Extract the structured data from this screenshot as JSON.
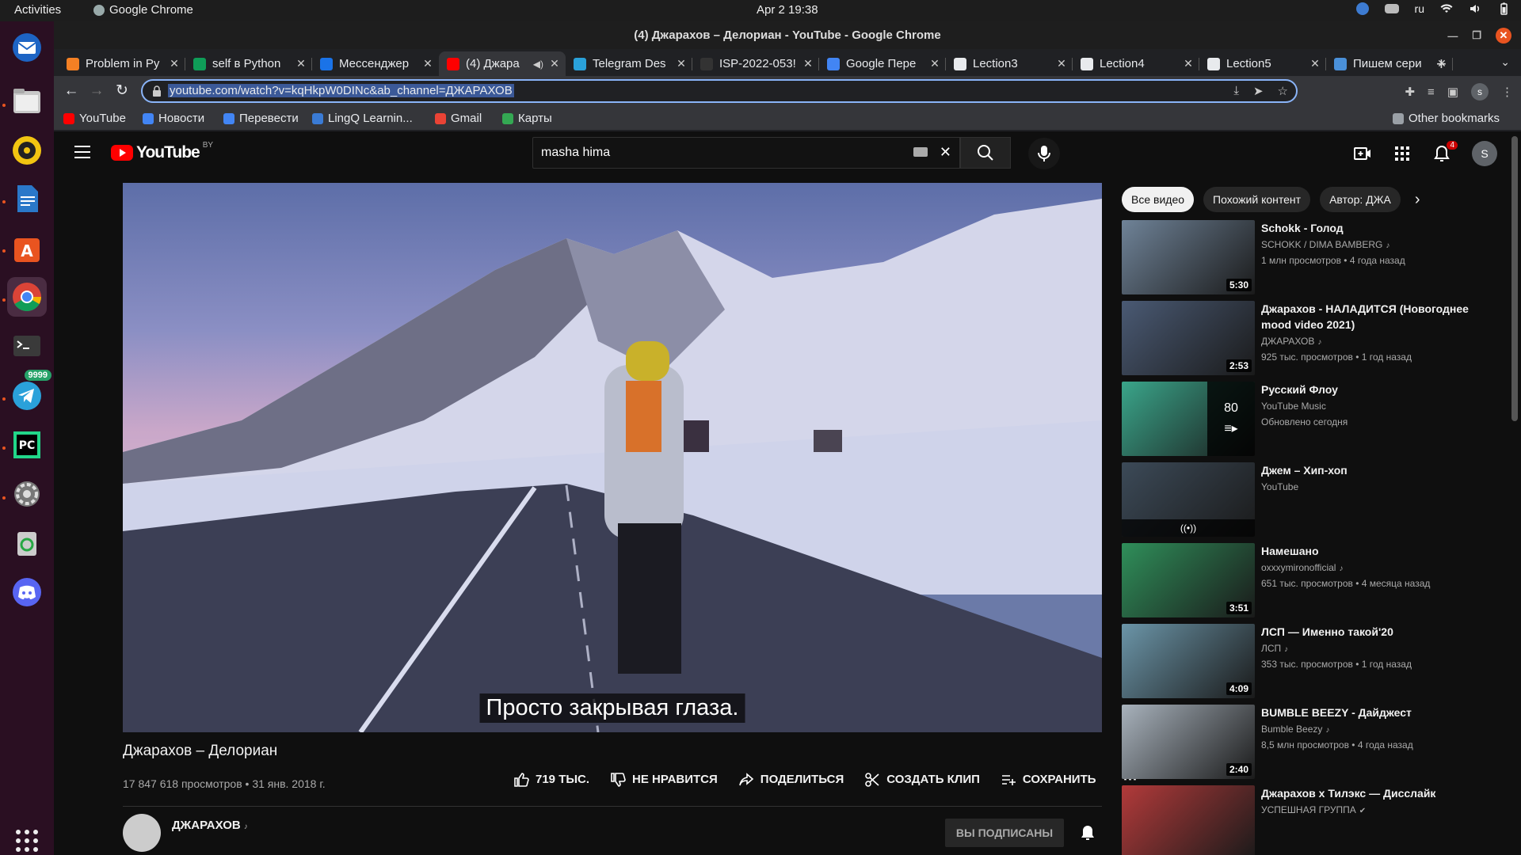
{
  "desktop": {
    "activities": "Activities",
    "app_name": "Google Chrome",
    "clock": "Apr 2  19:38",
    "lang": "ru",
    "telegram_badge": "9999"
  },
  "window": {
    "title": "(4) Джарахов – Делориан - YouTube - Google Chrome"
  },
  "tabs": [
    {
      "label": "Problem in Py",
      "color": "#f48024"
    },
    {
      "label": "self в Python",
      "color": "#0f9d58"
    },
    {
      "label": "Мессенджер",
      "color": "#1a73e8"
    },
    {
      "label": "(4) Джара",
      "color": "#ff0000"
    },
    {
      "label": "Telegram Des",
      "color": "#2aa1da"
    },
    {
      "label": "ISP-2022-053!",
      "color": "#333333"
    },
    {
      "label": "Google Пере",
      "color": "#4285f4"
    },
    {
      "label": "Lection3",
      "color": "#e8eaed"
    },
    {
      "label": "Lection4",
      "color": "#e8eaed"
    },
    {
      "label": "Lection5",
      "color": "#e8eaed"
    },
    {
      "label": "Пишем сери",
      "color": "#4a90d9"
    }
  ],
  "omnibox": {
    "url": "youtube.com/watch?v=kqHkpW0DINc&ab_channel=ДЖАРАХОВ"
  },
  "bookmarks": [
    {
      "label": "YouTube",
      "color": "#ff0000"
    },
    {
      "label": "Новости",
      "color": "#4285f4"
    },
    {
      "label": "Перевести",
      "color": "#4285f4"
    },
    {
      "label": "LingQ Learnin...",
      "color": "#3a7bd5"
    },
    {
      "label": "Gmail",
      "color": "#ea4335"
    },
    {
      "label": "Карты",
      "color": "#34a853"
    }
  ],
  "other_bookmarks": "Other bookmarks",
  "youtube": {
    "logo_text": "YouTube",
    "country": "BY",
    "search_query": "masha hima",
    "notif_count": "4",
    "avatar_letter": "S",
    "subtitle": "Просто закрывая глаза.",
    "video_title": "Джарахов – Делориан",
    "video_meta": "17 847 618 просмотров • 31 янв. 2018 г.",
    "actions": {
      "like": "719 ТЫС.",
      "dislike": "НЕ НРАВИТСЯ",
      "share": "ПОДЕЛИТЬСЯ",
      "clip": "СОЗДАТЬ КЛИП",
      "save": "СОХРАНИТЬ"
    },
    "channel_name": "ДЖАРАХОВ",
    "subscribe_label": "ВЫ ПОДПИСАНЫ",
    "chips": [
      "Все видео",
      "Похожий контент",
      "Автор: ДЖА"
    ],
    "recs": [
      {
        "title": "Schokk - Голод",
        "channel": "SCHOKK / DIMA BAMBERG",
        "stats": "1 млн просмотров • 4 года назад",
        "duration": "5:30",
        "thumb": "#6f8398"
      },
      {
        "title": "Джарахов - НАЛАДИТСЯ (Новогоднее mood video 2021)",
        "channel": "ДЖАРАХОВ",
        "stats": "925 тыс. просмотров • 1 год назад",
        "duration": "2:53",
        "thumb": "#4a5a74"
      },
      {
        "title": "Русский Флоу",
        "channel": "YouTube Music",
        "stats": "Обновлено сегодня",
        "playlist_count": "80",
        "thumb": "#3aa58a"
      },
      {
        "title": "Джем – Хип-хоп",
        "channel": "YouTube",
        "stats": "",
        "thumb": "#3c4a58"
      },
      {
        "title": "Намешано",
        "channel": "oxxxymironofficial",
        "stats": "651 тыс. просмотров • 4 месяца назад",
        "duration": "3:51",
        "thumb": "#2f8f5a"
      },
      {
        "title": "ЛСП — Именно такой'20",
        "channel": "ЛСП",
        "stats": "353 тыс. просмотров • 1 год назад",
        "duration": "4:09",
        "thumb": "#6b95a8"
      },
      {
        "title": "BUMBLE BEEZY - Дайджест",
        "channel": "Bumble Beezy",
        "stats": "8,5 млн просмотров • 4 года назад",
        "duration": "2:40",
        "thumb": "#a8b2bc"
      },
      {
        "title": "Джарахов x Тилэкс — Дисслайк",
        "channel": "УСПЕШНАЯ ГРУППА",
        "stats": "",
        "thumb": "#b23a3a"
      }
    ]
  }
}
